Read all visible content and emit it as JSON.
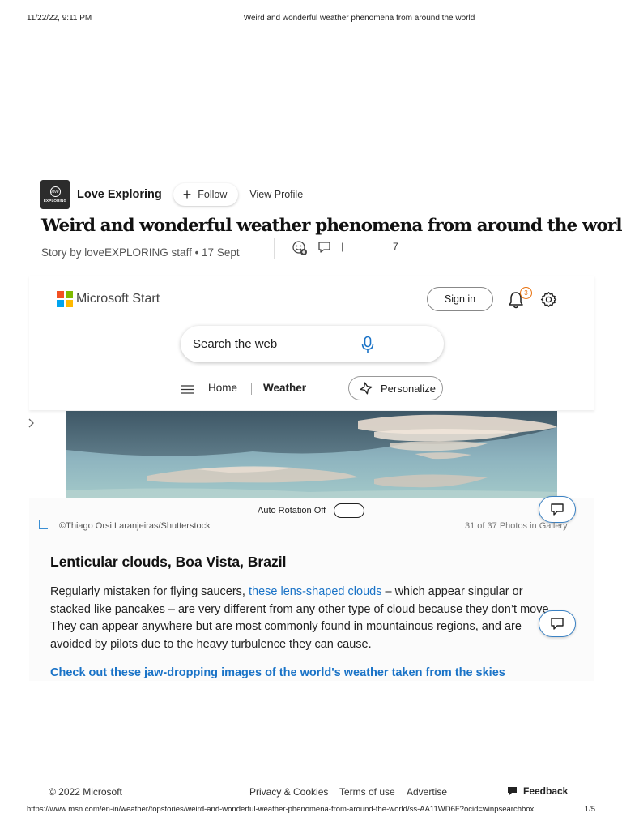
{
  "print_header": {
    "datetime": "11/22/22, 9:11 PM",
    "title": "Weird and wonderful weather phenomena from around the world"
  },
  "author": {
    "logo_text": "EXPLORING",
    "name": "Love Exploring",
    "follow_label": "Follow",
    "view_profile_label": "View Profile"
  },
  "article": {
    "headline": "Weird and wonderful weather phenomena from around the world",
    "byline": "Story by loveEXPLORING staff • 17 Sept",
    "comment_count": "7"
  },
  "msn_header": {
    "brand": "Microsoft Start",
    "signin_label": "Sign in",
    "notification_count": "3",
    "search_placeholder": "Search the web",
    "nav": {
      "home": "Home",
      "weather": "Weather",
      "personalize": "Personalize"
    },
    "colors": {
      "ms_red": "#f25022",
      "ms_green": "#7fba00",
      "ms_blue": "#00a4ef",
      "ms_yellow": "#ffb900",
      "accent_blue": "#1a73c7"
    }
  },
  "gallery": {
    "auto_rotation_label": "Auto Rotation Off",
    "photo_credit": "©Thiago Orsi Laranjeiras/Shutterstock",
    "photo_count": "31 of 37 Photos in Gallery",
    "caption_title": "Lenticular clouds, Boa Vista, Brazil",
    "caption_lines": {
      "line1_before": "Regularly mistaken for flying saucers, ",
      "line1_link": "these lens-shaped clouds",
      "line1_after": " – which appear singular or",
      "line2": "stacked like pancakes – are very different from any other type of cloud because they don’t move.",
      "line3": "They can appear anywhere but are most commonly found in mountainous regions, and are",
      "line4": "avoided by pilots due to the heavy turbulence they can cause."
    },
    "cta_link": "Check out these jaw-dropping images of the world's weather taken from the skies"
  },
  "site_footer": {
    "copyright": "© 2022 Microsoft",
    "privacy": "Privacy & Cookies",
    "terms": "Terms of use",
    "advertise": "Advertise",
    "feedback": "Feedback"
  },
  "print_footer": {
    "url": "https://www.msn.com/en-in/weather/topstories/weird-and-wonderful-weather-phenomena-from-around-the-world/ss-AA11WD6F?ocid=winpsearchbox…",
    "page": "1/5"
  }
}
